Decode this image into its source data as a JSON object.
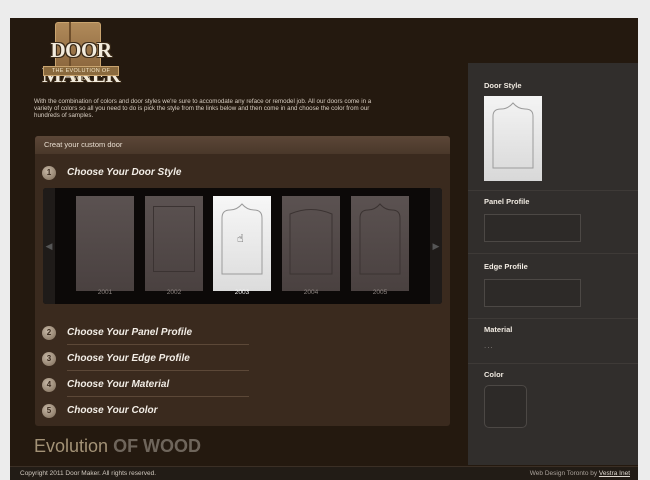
{
  "logo": {
    "name": "DOOR MAKER",
    "tagline": "THE EVOLUTION OF WOOD"
  },
  "intro": "With the combination of colors and door styles we're sure to accomodate any reface or remodel job. All our doors come in a variety of colors so all you need to do is pick the style from the links below and then come in and choose the color from our hundreds of samples.",
  "builder": {
    "header": "Creat your custom door",
    "steps": [
      {
        "num": "1",
        "label": "Choose Your Door Style"
      },
      {
        "num": "2",
        "label": "Choose Your Panel Profile"
      },
      {
        "num": "3",
        "label": "Choose Your Edge Profile"
      },
      {
        "num": "4",
        "label": "Choose Your Material"
      },
      {
        "num": "5",
        "label": "Choose Your Color"
      }
    ],
    "doors": [
      {
        "code": "2001",
        "icon": "flat-door-icon",
        "style": "flat",
        "selected": false
      },
      {
        "code": "2002",
        "icon": "square-panel-door-icon",
        "style": "square",
        "selected": false
      },
      {
        "code": "2003",
        "icon": "cathedral-arch-door-icon",
        "style": "cathedral",
        "selected": true
      },
      {
        "code": "2004",
        "icon": "shallow-arch-door-icon",
        "style": "arch",
        "selected": false
      },
      {
        "code": "2005",
        "icon": "cathedral-arch-door-icon",
        "style": "cathedral",
        "selected": false
      }
    ],
    "arrows": {
      "prev": "◀",
      "next": "▶"
    }
  },
  "evolution": {
    "part1": "Evolution ",
    "part2": "OF WOOD"
  },
  "sidebar": {
    "door_style": "Door Style",
    "panel_profile": "Panel Profile",
    "edge_profile": "Edge Profile",
    "material": "Material",
    "material_value": "...",
    "color": "Color"
  },
  "footer": {
    "copyright": "Copyright 2011 Door Maker. All rights reserved.",
    "credit_text": "Web Design Toronto by ",
    "credit_link": "Vestra Inet"
  },
  "colors": {
    "background": "#24190f",
    "panel": "#3a2a1e",
    "sidebar": "#312e2c",
    "accent": "#a39276"
  }
}
